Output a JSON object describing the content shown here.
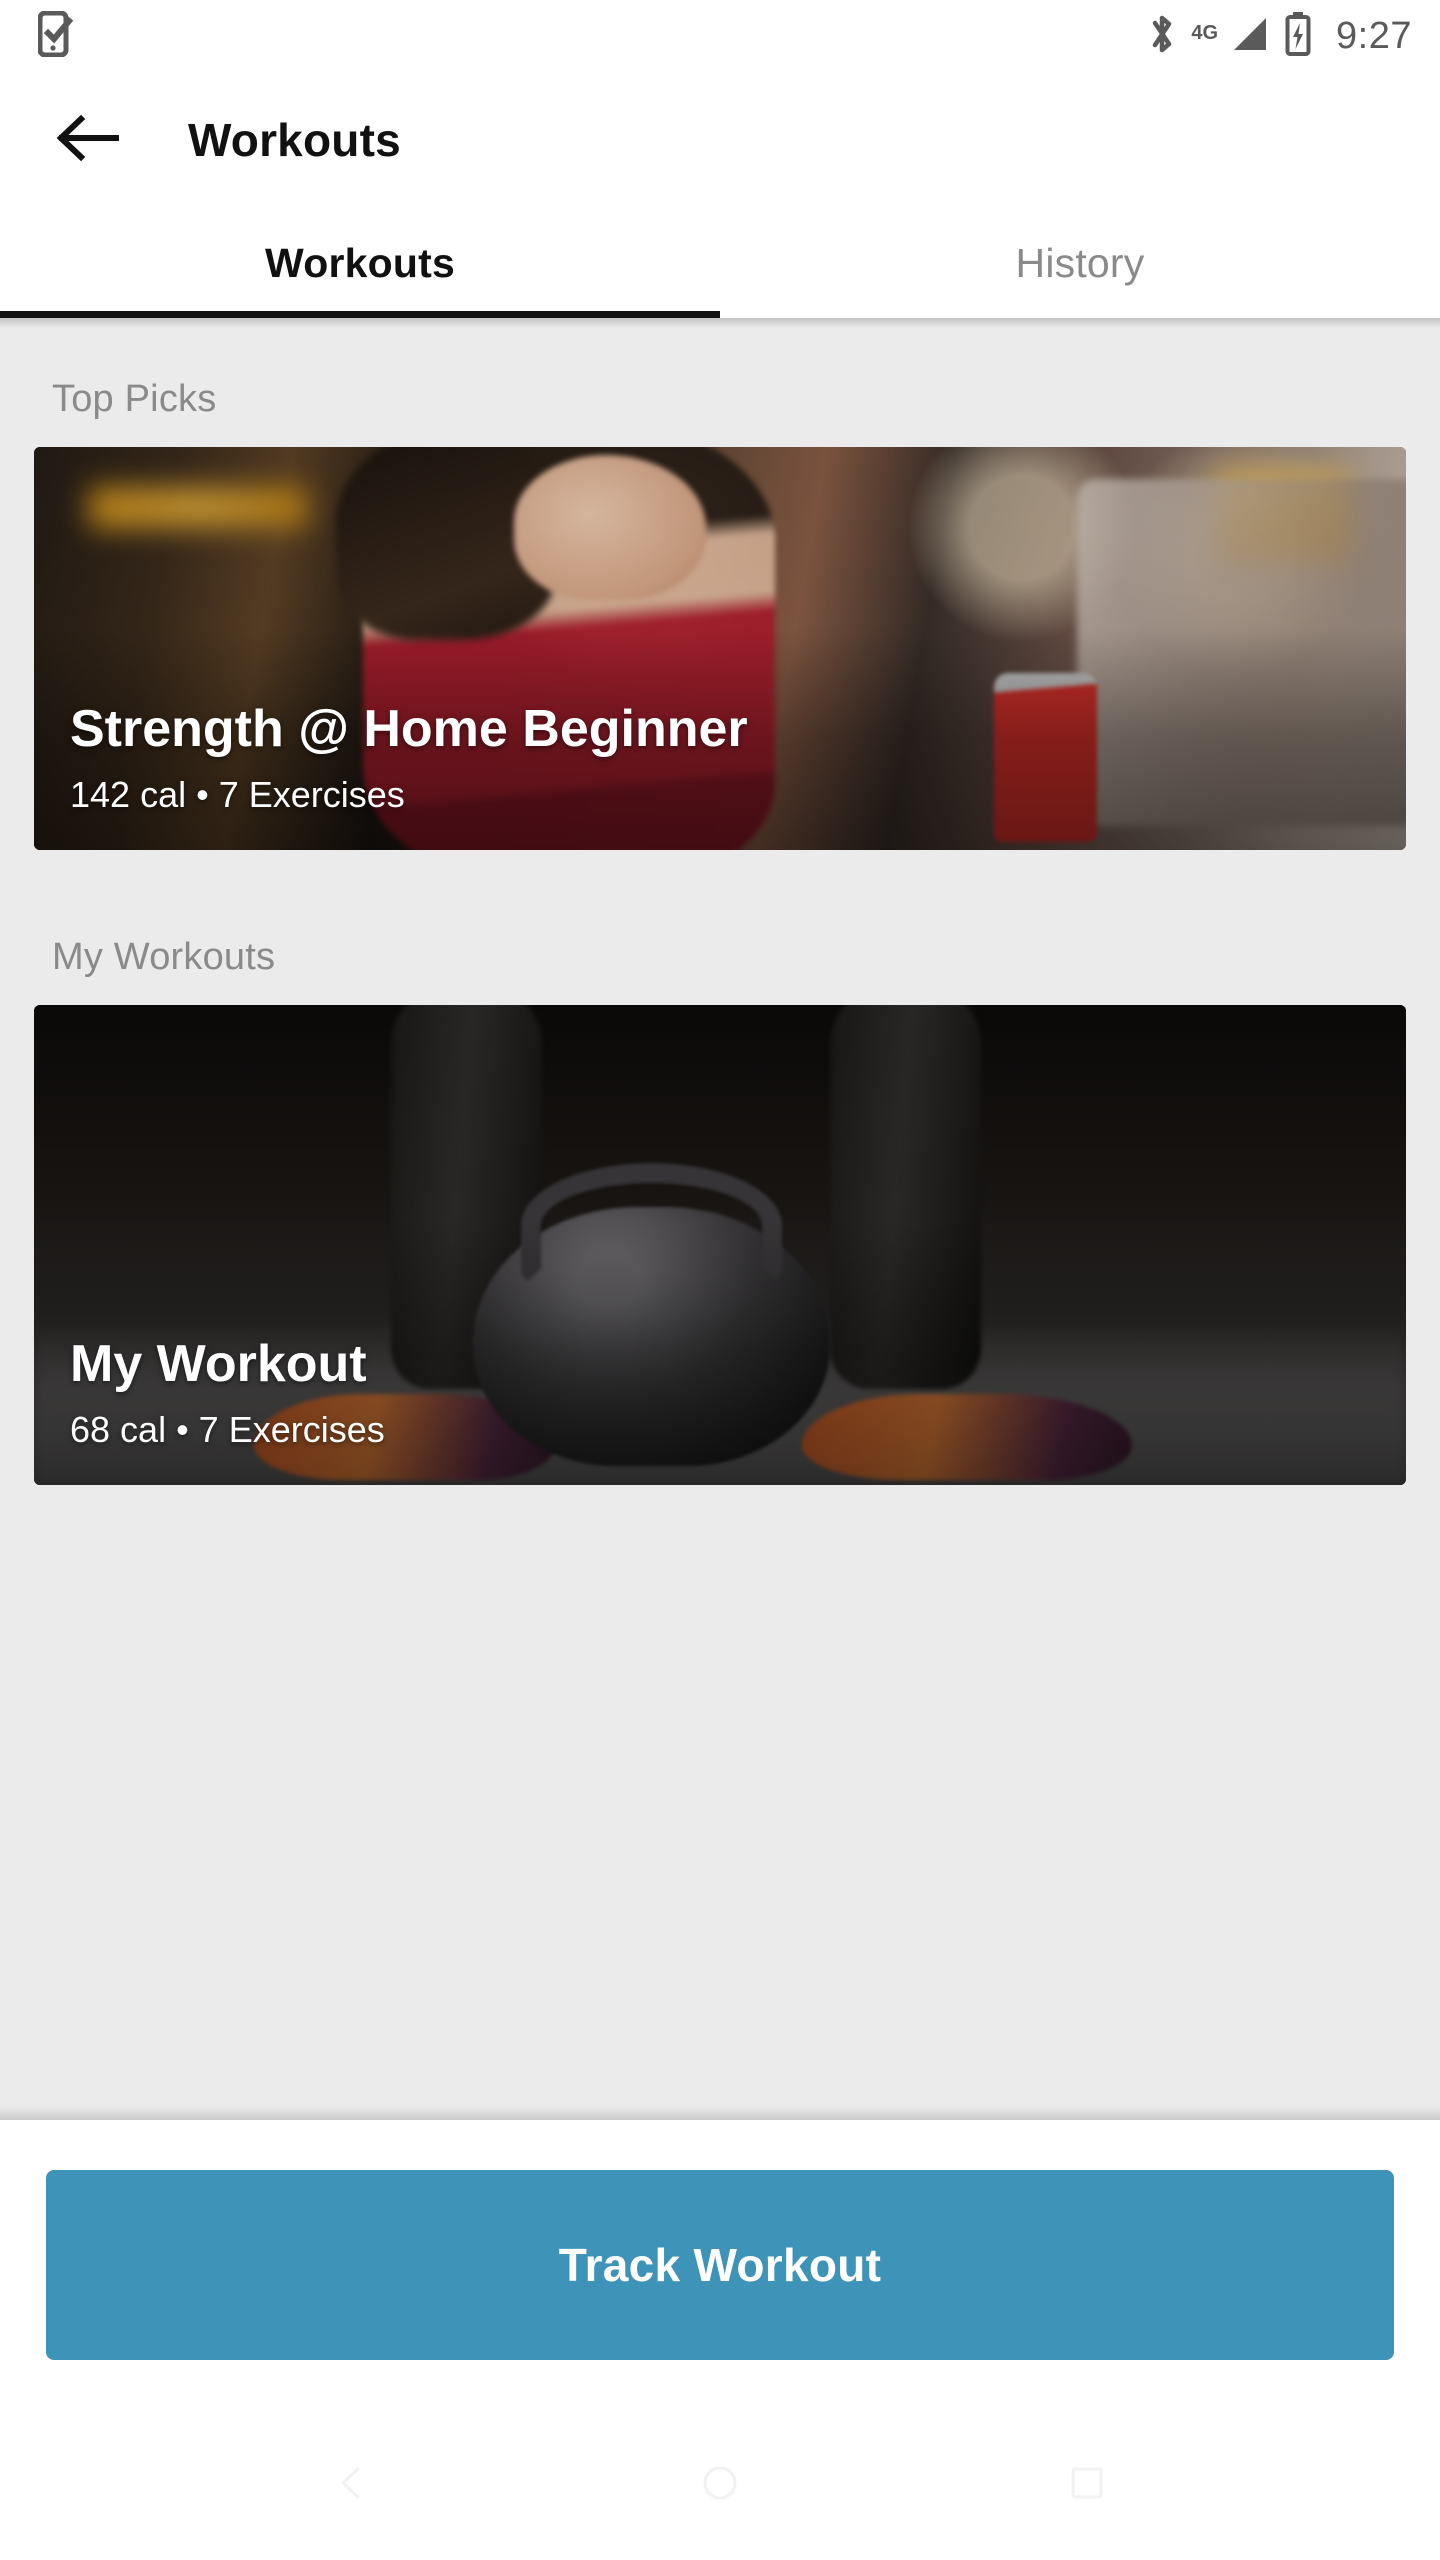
{
  "status_bar": {
    "left_icon": "phone-check-icon",
    "bluetooth_icon": "bluetooth-icon",
    "network_label": "4G",
    "signal_icon": "signal-bars-icon",
    "battery_icon": "battery-charging-icon",
    "time": "9:27"
  },
  "app_bar": {
    "back_icon": "arrow-left-icon",
    "title": "Workouts"
  },
  "tabs": [
    {
      "label": "Workouts",
      "active": true
    },
    {
      "label": "History",
      "active": false
    }
  ],
  "sections": [
    {
      "title": "Top Picks",
      "cards": [
        {
          "title": "Strength @ Home Beginner",
          "subtitle": "142 cal • 7 Exercises",
          "calories": "142 cal",
          "exercises": "7 Exercises",
          "image": "woman-boxing-in-gym-photo"
        }
      ]
    },
    {
      "title": "My Workouts",
      "cards": [
        {
          "title": "My Workout",
          "subtitle": "68 cal • 7 Exercises",
          "calories": "68 cal",
          "exercises": "7 Exercises",
          "image": "kettlebell-on-gym-floor-photo"
        }
      ]
    }
  ],
  "bottom_bar": {
    "primary_button_label": "Track Workout"
  },
  "nav_bar": {
    "back_icon": "triangle-back-icon",
    "home_icon": "circle-home-icon",
    "recents_icon": "square-recents-icon"
  },
  "colors": {
    "accent": "#3d94b8",
    "page_background": "#ebebeb",
    "surface": "#ffffff",
    "text_primary": "#111111",
    "text_muted": "#8a8a8a",
    "status_icon": "#5a5a5a"
  }
}
